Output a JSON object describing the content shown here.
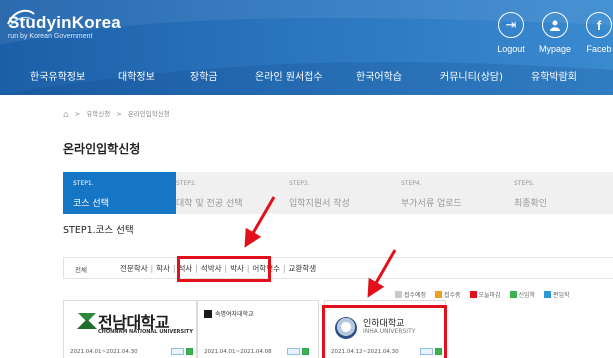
{
  "header": {
    "logo_main": "StudyinKorea",
    "logo_sub": "run by Korean Government",
    "top_icons": [
      {
        "label": "Logout",
        "icon": "logout-icon",
        "glyph": "⇥"
      },
      {
        "label": "Mypage",
        "icon": "user-icon",
        "glyph": "👤"
      },
      {
        "label": "Faceb",
        "icon": "facebook-icon",
        "glyph": "f"
      }
    ],
    "menu": [
      "한국유학정보",
      "대학정보",
      "장학금",
      "온라인 원서접수",
      "한국어학습",
      "커뮤니티(상담)",
      "유학박람회"
    ]
  },
  "breadcrumb": {
    "home_icon": "home-icon",
    "separator": ">",
    "items": [
      "유학신청",
      "온라인입학신청"
    ]
  },
  "page_title": "온라인입학신청",
  "steps": [
    {
      "no": "STEP1.",
      "name": "코스 선택",
      "active": true
    },
    {
      "no": "STEP2.",
      "name": "대학 및 전공 선택",
      "active": false
    },
    {
      "no": "STEP3.",
      "name": "입학지원서 작성",
      "active": false
    },
    {
      "no": "STEP4.",
      "name": "부가서류 업로드",
      "active": false
    },
    {
      "no": "STEP5.",
      "name": "최종확인",
      "active": false
    }
  ],
  "sub_title": "STEP1.코스 선택",
  "filter": {
    "all": "전체",
    "categories": [
      "전문학사",
      "학사",
      "석사",
      "석박사",
      "박사",
      "어학연수",
      "교환학생"
    ]
  },
  "legend": [
    {
      "label": "접수예정",
      "color": "#c9c9c9"
    },
    {
      "label": "접수중",
      "color": "#f0a020"
    },
    {
      "label": "오늘마감",
      "color": "#e3101b"
    },
    {
      "label": "신입학",
      "color": "#3bb14f"
    },
    {
      "label": "편입학",
      "color": "#2a9bd8"
    }
  ],
  "cards": [
    {
      "name": "전남대학교",
      "eng": "CHONNAM NATIONAL UNIVERSITY",
      "date": "2021.04.01~2021.04.30"
    },
    {
      "name": "숙명여자대학교",
      "date": "2021.04.01~2021.04.08"
    },
    {
      "name": "인하대학교",
      "eng": "INHA UNIVERSITY",
      "date": "2021.04.12~2021.04.30"
    }
  ],
  "colors": {
    "header": "#2a74bd",
    "active_step": "#1576c6",
    "annotation": "#e3101b"
  }
}
